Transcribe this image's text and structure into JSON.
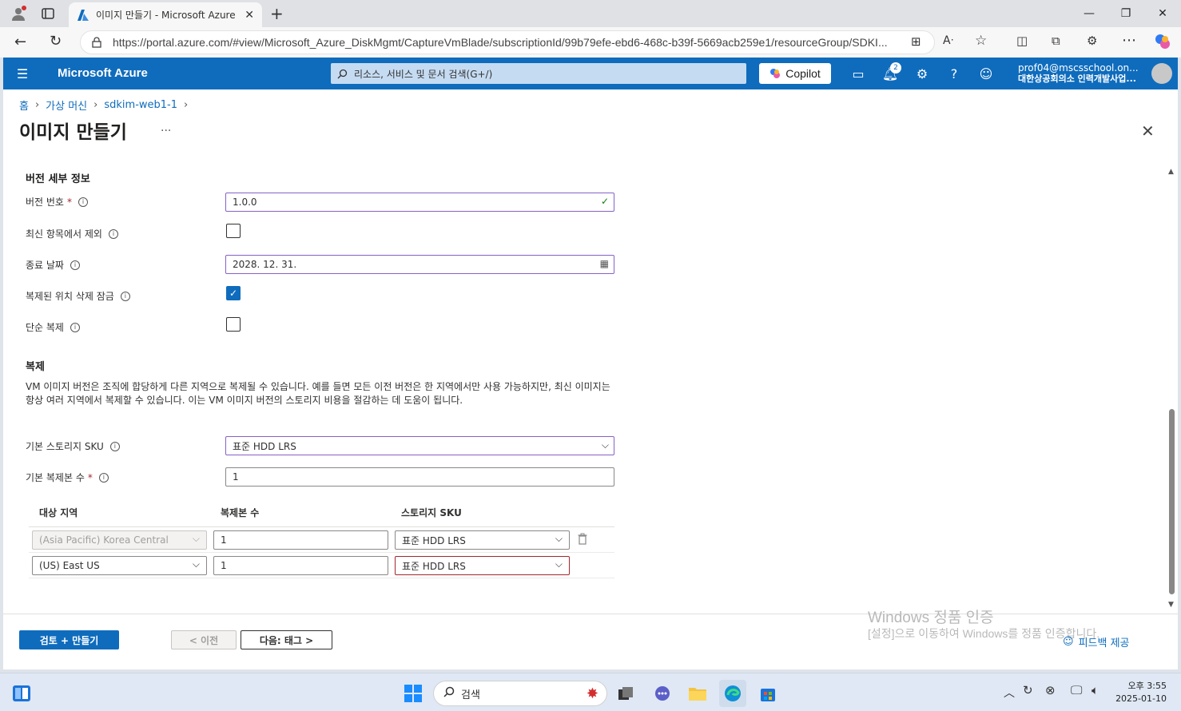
{
  "browser": {
    "tab_title": "이미지 만들기 - Microsoft Azure",
    "url": "https://portal.azure.com/#view/Microsoft_Azure_DiskMgmt/CaptureVmBlade/subscriptionId/99b79efe-ebd6-468c-b39f-5669acb259e1/resourceGroup/SDKI..."
  },
  "azure_header": {
    "brand": "Microsoft Azure",
    "search_placeholder": "리소스, 서비스 및 문서 검색(G+/)",
    "copilot_label": "Copilot",
    "notification_count": "2",
    "account_email": "prof04@mscsschool.on...",
    "account_org": "대한상공회의소 인력개발사업..."
  },
  "breadcrumb": [
    "홈",
    "가상 머신",
    "sdkim-web1-1"
  ],
  "page": {
    "title": "이미지 만들기",
    "more": "..."
  },
  "version_details": {
    "section_title": "버전 세부 정보",
    "version_number_label": "버전 번호",
    "version_number_value": "1.0.0",
    "exclude_latest_label": "최신 항목에서 제외",
    "end_date_label": "종료 날짜",
    "end_date_value": "2028. 12. 31.",
    "delete_lock_label": "복제된 위치 삭제 잠금",
    "shallow_replication_label": "단순 복제"
  },
  "replication": {
    "section_title": "복제",
    "description": "VM 이미지 버전은 조직에 합당하게 다른 지역으로 복제될 수 있습니다. 예를 들면 모든 이전 버전은 한 지역에서만 사용 가능하지만, 최신 이미지는 항상 여러 지역에서 복제할 수 있습니다. 이는 VM 이미지 버전의 스토리지 비용을 절감하는 데 도움이 됩니다.",
    "default_sku_label": "기본 스토리지 SKU",
    "default_sku_value": "표준 HDD LRS",
    "default_replica_label": "기본 복제본 수",
    "default_replica_value": "1",
    "table_headers": [
      "대상 지역",
      "복제본 수",
      "스토리지 SKU"
    ],
    "rows": [
      {
        "region": "(Asia Pacific) Korea Central",
        "replicas": "1",
        "sku": "표준 HDD LRS"
      },
      {
        "region": "(US) East US",
        "replicas": "1",
        "sku": "표준 HDD LRS"
      }
    ]
  },
  "footer": {
    "review_create": "검토 + 만들기",
    "previous": "< 이전",
    "next": "다음: 태그 >",
    "feedback": "피드백 제공"
  },
  "watermark": {
    "line1": "Windows 정품 인증",
    "line2": "[설정]으로 이동하여 Windows를 정품 인증합니다."
  },
  "taskbar": {
    "search_placeholder": "검색",
    "time": "오후 3:55",
    "date": "2025-01-10"
  },
  "colors": {
    "azure_blue": "#0f6cbd",
    "focus_purple": "#8661c5",
    "error_red": "#a4262c"
  }
}
